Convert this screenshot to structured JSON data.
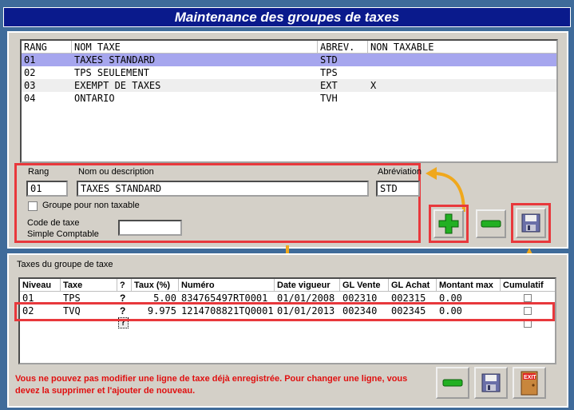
{
  "window": {
    "title": "Maintenance des groupes de taxes"
  },
  "groups_table": {
    "headers": [
      "RANG",
      "NOM TAXE",
      "ABREV.",
      "NON TAXABLE"
    ],
    "rows": [
      [
        "01",
        "TAXES STANDARD",
        "STD",
        ""
      ],
      [
        "02",
        "TPS SEULEMENT",
        "TPS",
        ""
      ],
      [
        "03",
        "EXEMPT DE TAXES",
        "EXT",
        "X"
      ],
      [
        "04",
        "ONTARIO",
        "TVH",
        ""
      ]
    ]
  },
  "edit_form": {
    "rang_label": "Rang",
    "rang_value": "01",
    "name_label": "Nom ou description",
    "name_value": "TAXES STANDARD",
    "abrev_label": "Abréviation",
    "abrev_value": "STD",
    "non_taxable_label": "Groupe pour non taxable",
    "code_label_1": "Code de taxe",
    "code_label_2": "Simple Comptable",
    "code_value": ""
  },
  "taxes_section": {
    "label": "Taxes du groupe de taxe",
    "headers": [
      "Niveau",
      "Taxe",
      "?",
      "Taux (%)",
      "Numéro",
      "Date vigueur",
      "GL Vente",
      "GL Achat",
      "Montant max",
      "Cumulatif"
    ],
    "rows": [
      [
        "01",
        "TPS",
        "?",
        "5.00",
        "834765497RT0001",
        "01/01/2008",
        "002310",
        "002315",
        "0.00"
      ],
      [
        "02",
        "TVQ",
        "?",
        "9.975",
        "1214708821TQ0001",
        "01/01/2013",
        "002340",
        "002345",
        "0.00"
      ]
    ],
    "new_row_marker": "?"
  },
  "warning": "Vous ne pouvez pas modifier une ligne de taxe déjà enregistrée. Pour changer une ligne, vous devez la supprimer et l'ajouter de nouveau.",
  "icons": {
    "add": "plus-icon",
    "remove": "minus-icon",
    "save": "floppy-icon",
    "exit": "exit-door-icon",
    "exit_text": "EXIT"
  },
  "colors": {
    "title_bg": "#0a1a8c",
    "selected_row": "#a6a6ee",
    "highlight": "#e8383c",
    "annotation_arrow": "#f0a81c",
    "warning_text": "#e01010"
  }
}
